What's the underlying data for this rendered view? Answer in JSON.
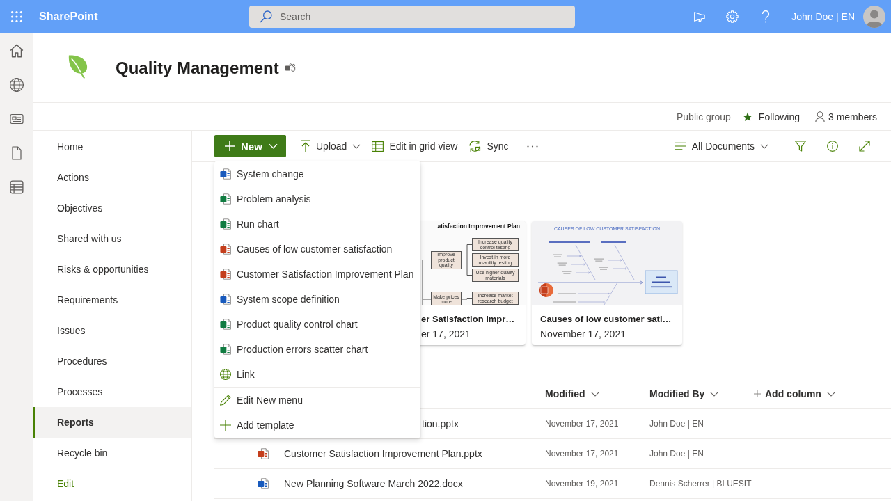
{
  "app_bar": {
    "app_name": "SharePoint",
    "search": {
      "placeholder": "Search"
    },
    "user_name": "John Doe | EN"
  },
  "site_header": {
    "title": "Quality Management",
    "privacy": "Public group",
    "follow": {
      "label": "Following",
      "on": true
    },
    "members": "3 members"
  },
  "nav": {
    "items": [
      {
        "label": "Home",
        "selected": false
      },
      {
        "label": "Actions",
        "selected": false
      },
      {
        "label": "Objectives",
        "selected": false
      },
      {
        "label": "Shared with us",
        "selected": false
      },
      {
        "label": "Risks & opportunities",
        "selected": false
      },
      {
        "label": "Requirements",
        "selected": false
      },
      {
        "label": "Issues",
        "selected": false
      },
      {
        "label": "Procedures",
        "selected": false
      },
      {
        "label": "Processes",
        "selected": false
      },
      {
        "label": "Reports",
        "selected": true
      },
      {
        "label": "Recycle bin",
        "selected": false
      }
    ],
    "edit_link": "Edit"
  },
  "command_bar": {
    "new_button": {
      "label": "New",
      "expanded": true
    },
    "upload": "Upload",
    "edit_grid": "Edit in grid view",
    "sync": "Sync",
    "view": "All Documents"
  },
  "new_menu": {
    "templates": [
      {
        "label": "System change",
        "kind": "document"
      },
      {
        "label": "Problem analysis",
        "kind": "spreadsheet"
      },
      {
        "label": "Run chart",
        "kind": "spreadsheet"
      },
      {
        "label": "Causes of low customer satisfaction",
        "kind": "presentation"
      },
      {
        "label": "Customer Satisfaction Improvement Plan",
        "kind": "presentation"
      },
      {
        "label": "System scope definition",
        "kind": "document"
      },
      {
        "label": "Product quality control chart",
        "kind": "spreadsheet"
      },
      {
        "label": "Production errors scatter chart",
        "kind": "spreadsheet"
      },
      {
        "label": "Link",
        "kind": "link"
      }
    ],
    "actions": [
      {
        "label": "Edit New menu",
        "kind": "edit"
      },
      {
        "label": "Add template",
        "kind": "add"
      }
    ]
  },
  "cards": [
    {
      "title": "er Satisfaction Impr…",
      "date": "er 17, 2021",
      "thumbnail": {
        "kind": "tree",
        "title": "atisfaction Improvement Plan",
        "branches": [
          {
            "label": "Improve product quality",
            "children": [
              "Increase quality control testing",
              "Invest in more usability testing",
              "Use higher quality materials"
            ]
          },
          {
            "label": "Make prices more",
            "children": [
              "Increase market research budget"
            ]
          }
        ]
      }
    },
    {
      "title": "Causes of low customer sati…",
      "date": "November 17, 2021",
      "file": {
        "kind": "presentation"
      },
      "thumbnail": {
        "kind": "fishbone",
        "title": "CAUSES OF LOW CUSTOMER SATISFACTION"
      }
    }
  ],
  "document_list": {
    "columns": [
      {
        "label": "Modified",
        "kind": "sort"
      },
      {
        "label": "Modified By",
        "kind": "sort"
      },
      {
        "label": "Add column",
        "kind": "add"
      }
    ],
    "rows": [
      {
        "name": "tion.pptx",
        "modified": "November 17, 2021",
        "modified_by": "John Doe | EN"
      },
      {
        "kind": "presentation",
        "name": "Customer Satisfaction Improvement Plan.pptx",
        "modified": "November 17, 2021",
        "modified_by": "John Doe | EN"
      },
      {
        "kind": "document",
        "name": "New Planning Software March 2022.docx",
        "modified": "November 19, 2021",
        "modified_by": "Dennis Scherrer | BLUESIT"
      }
    ]
  }
}
